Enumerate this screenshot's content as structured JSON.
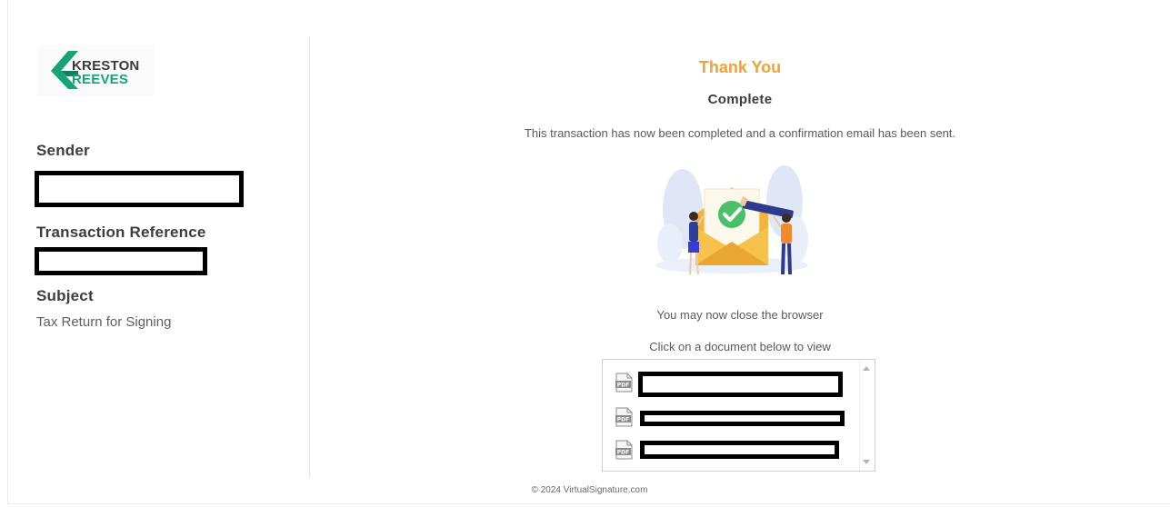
{
  "brand": {
    "logo_line1": "KRESTON",
    "logo_line2": "REEVES",
    "colors": {
      "accent": "#f0a238",
      "brand_green": "#17a377"
    }
  },
  "sidebar": {
    "sender_label": "Sender",
    "transaction_reference_label": "Transaction Reference",
    "subject_label": "Subject",
    "subject_value": "Tax Return for Signing"
  },
  "main": {
    "heading": "Thank You",
    "status": "Complete",
    "message": "This transaction has now been completed and a confirmation email has been sent.",
    "close_browser": "You may now close the browser",
    "click_document": "Click on a document below to view",
    "documents": [
      {
        "icon": "pdf-icon",
        "type": "PDF"
      },
      {
        "icon": "pdf-icon",
        "type": "PDF"
      },
      {
        "icon": "pdf-icon",
        "type": "PDF"
      }
    ]
  },
  "footer": {
    "copyright": "© 2024 VirtualSignature.com"
  }
}
